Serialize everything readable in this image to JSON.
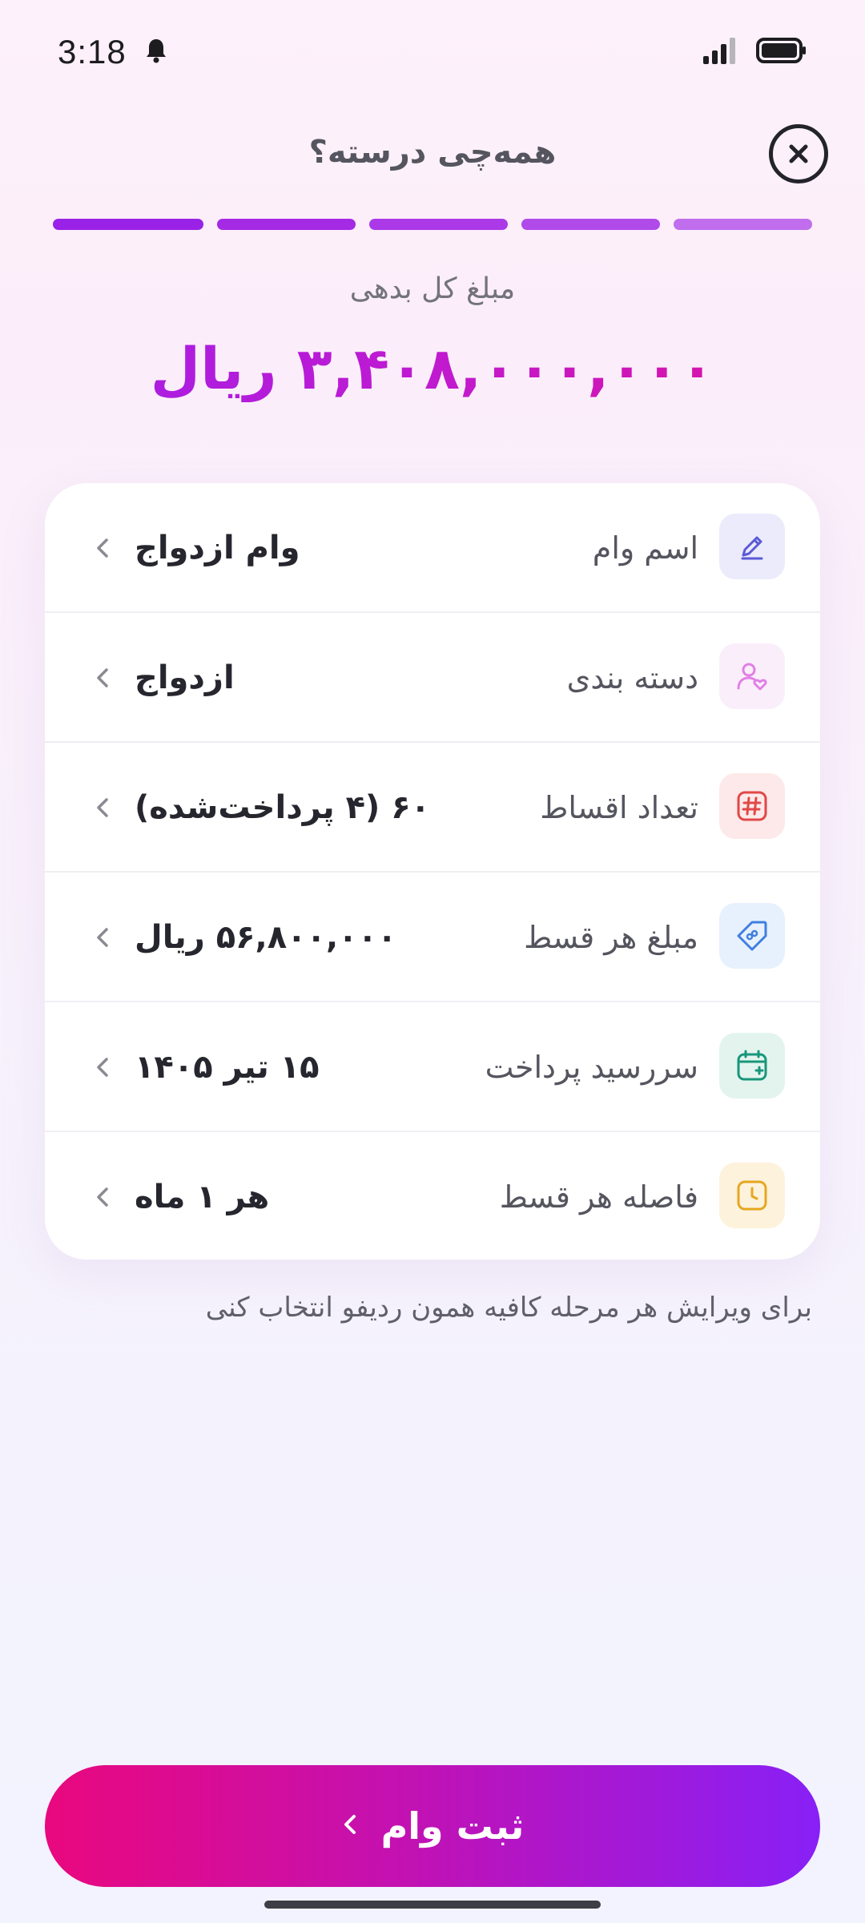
{
  "status_bar": {
    "time": "3:18"
  },
  "header": {
    "title": "همه‌چی درسته؟"
  },
  "progress": {
    "steps_total": 5,
    "steps_complete": 5,
    "colors": [
      "#9a22e6",
      "#a42ae4",
      "#ac39e7",
      "#b04bea",
      "#c06dee"
    ]
  },
  "summary": {
    "label": "مبلغ کل بدهی",
    "amount": "۳,۴۰۸,۰۰۰,۰۰۰ ریال"
  },
  "details": {
    "rows": [
      {
        "label": "اسم وام",
        "value": "وام ازدواج",
        "icon": "pencil-icon",
        "accent": "#5a5ad6",
        "bg": "#ebebfb"
      },
      {
        "label": "دسته بندی",
        "value": "ازدواج",
        "icon": "user-heart-icon",
        "accent": "#e080e6",
        "bg": "#fbeefb"
      },
      {
        "label": "تعداد اقساط",
        "value": "۶۰ (۴ پرداخت‌شده)",
        "icon": "hash-icon",
        "accent": "#e04848",
        "bg": "#fde9e9"
      },
      {
        "label": "مبلغ هر قسط",
        "value": "۵۶,۸۰۰,۰۰۰ ریال",
        "icon": "tag-icon",
        "accent": "#3f7fe0",
        "bg": "#e7f0fd"
      },
      {
        "label": "سررسید پرداخت",
        "value": "۱۵ تیر ۱۴۰۵",
        "icon": "calendar-plus-icon",
        "accent": "#18967a",
        "bg": "#e3f4ef"
      },
      {
        "label": "فاصله هر قسط",
        "value": "هر ۱ ماه",
        "icon": "clock-icon",
        "accent": "#e6a720",
        "bg": "#fdf2dc"
      }
    ]
  },
  "hint": "برای ویرایش هر مرحله کافیه همون ردیفو انتخاب کنی",
  "submit": {
    "label": "ثبت وام"
  }
}
